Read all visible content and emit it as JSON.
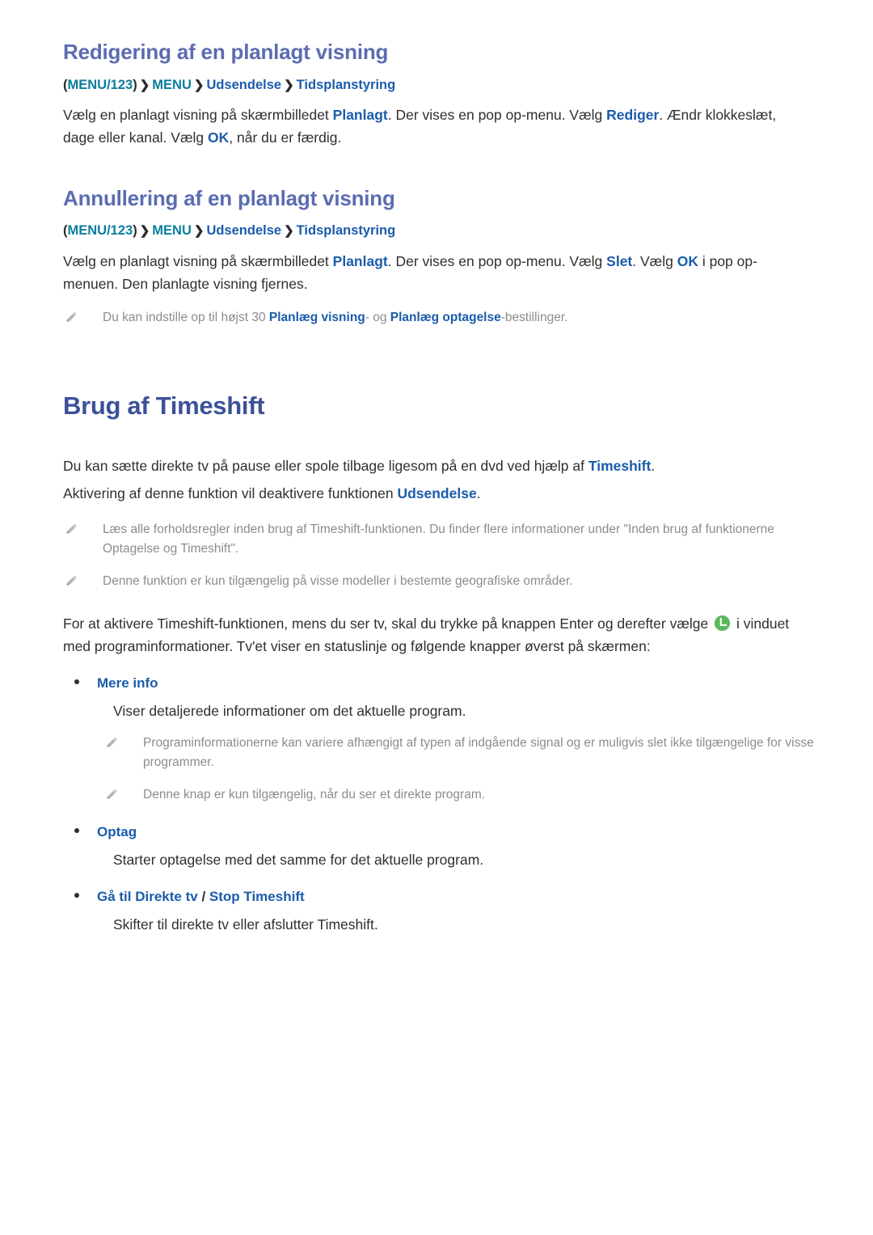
{
  "sections": [
    {
      "heading": "Redigering af en planlagt visning",
      "breadcrumb": {
        "open_paren": "(",
        "menu123": "MENU/123",
        "close_paren": ")",
        "sep": "❯",
        "menu": "MENU",
        "level2": "Udsendelse",
        "level3": "Tidsplanstyring"
      },
      "body": {
        "p1_a": "Vælg en planlagt visning på skærmbilledet ",
        "p1_kw1": "Planlagt",
        "p1_b": ". Der vises en pop op-menu. Vælg ",
        "p1_kw2": "Rediger",
        "p1_c": ". Ændr klokkeslæt, dage eller kanal. Vælg ",
        "p1_kw3": "OK",
        "p1_d": ", når du er færdig."
      }
    },
    {
      "heading": "Annullering af en planlagt visning",
      "breadcrumb": {
        "open_paren": "(",
        "menu123": "MENU/123",
        "close_paren": ")",
        "sep": "❯",
        "menu": "MENU",
        "level2": "Udsendelse",
        "level3": "Tidsplanstyring"
      },
      "body": {
        "p1_a": "Vælg en planlagt visning på skærmbilledet ",
        "p1_kw1": "Planlagt",
        "p1_b": ". Der vises en pop op-menu. Vælg ",
        "p1_kw2": "Slet",
        "p1_c": ". Vælg ",
        "p1_kw3": "OK",
        "p1_d": " i pop op-menuen. Den planlagte visning fjernes."
      },
      "note": {
        "a": "Du kan indstille op til højst 30 ",
        "kw1": "Planlæg visning",
        "b": "- og ",
        "kw2": "Planlæg optagelse",
        "c": "-bestillinger."
      }
    }
  ],
  "main": {
    "title": "Brug af Timeshift",
    "intro1_a": "Du kan sætte direkte tv på pause eller spole tilbage ligesom på en dvd ved hjælp af ",
    "intro1_kw": "Timeshift",
    "intro1_b": ".",
    "intro2_a": "Aktivering af denne funktion vil deaktivere funktionen ",
    "intro2_kw": "Udsendelse",
    "intro2_b": ".",
    "notes": [
      "Læs alle forholdsregler inden brug af Timeshift-funktionen. Du finder flere informationer under \"Inden brug af funktionerne Optagelse og Timeshift\".",
      "Denne funktion er kun tilgængelig på visse modeller i bestemte geografiske områder."
    ],
    "activate_a": "For at aktivere Timeshift-funktionen, mens du ser tv, skal du trykke på knappen Enter og derefter vælge ",
    "activate_icon": "timeshift-green-icon",
    "activate_b": " i vinduet med programinformationer. Tv'et viser en statuslinje og følgende knapper øverst på skærmen:",
    "buttons": [
      {
        "label": "Mere info",
        "label_suffix": "",
        "label_sep": "",
        "label_alt": "",
        "desc": "Viser detaljerede informationer om det aktuelle program.",
        "notes": [
          "Programinformationerne kan variere afhængigt af typen af indgående signal og er muligvis slet ikke tilgængelige for visse programmer.",
          "Denne knap er kun tilgængelig, når du ser et direkte program."
        ]
      },
      {
        "label": "Optag",
        "label_suffix": "",
        "label_sep": "",
        "label_alt": "",
        "desc": "Starter optagelse med det samme for det aktuelle program.",
        "notes": []
      },
      {
        "label": "Gå til Direkte tv",
        "label_sep": " / ",
        "label_alt": "Stop Timeshift",
        "desc": "Skifter til direkte tv eller afslutter Timeshift.",
        "notes": []
      }
    ]
  },
  "colors": {
    "section_heading": "#5b6cb0",
    "main_heading": "#3b5199",
    "keyword_blue": "#1b5cab",
    "breadcrumb_teal": "#0b7e9e",
    "note_gray": "#8c8c8c",
    "body_text": "#2f2f2f",
    "timeshift_green": "#5cb85c"
  }
}
